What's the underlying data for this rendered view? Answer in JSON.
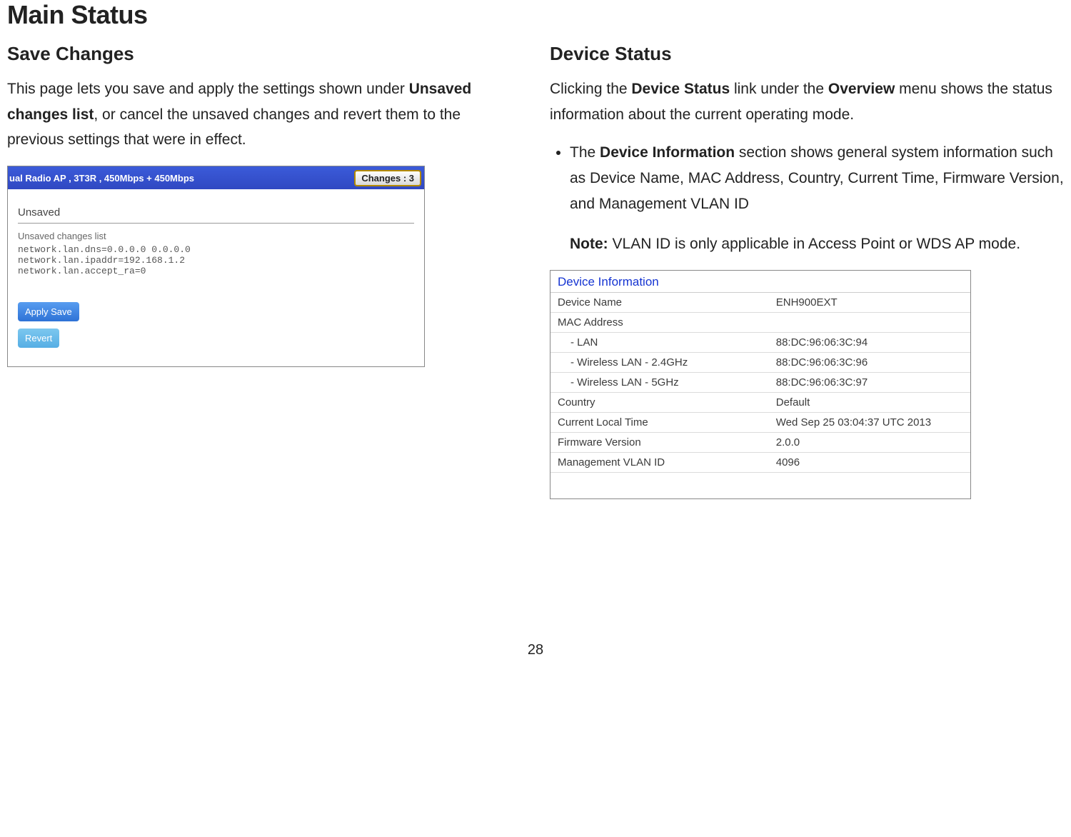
{
  "page_title": "Main Status",
  "page_number": "28",
  "left": {
    "heading": "Save Changes",
    "para_pre": "This page lets you save and apply the settings shown under ",
    "para_bold": "Unsaved changes list",
    "para_post": ", or cancel the unsaved changes and revert them to the previous settings that were in effect.",
    "shot": {
      "top_title": "ual Radio AP , 3T3R , 450Mbps + 450Mbps",
      "changes_btn": "Changes : 3",
      "unsaved_hdr": "Unsaved",
      "unsaved_sub": "Unsaved changes list",
      "lines": "network.lan.dns=0.0.0.0 0.0.0.0\nnetwork.lan.ipaddr=192.168.1.2\nnetwork.lan.accept_ra=0",
      "apply_label": "Apply Save",
      "revert_label": "Revert"
    }
  },
  "right": {
    "heading": "Device Status",
    "intro_1a": "Clicking the ",
    "intro_1b": "Device Status",
    "intro_1c": " link under the ",
    "intro_1d": "Overview",
    "intro_1e": " menu shows the status information about the current operating mode.",
    "bullet_a": "The ",
    "bullet_b": "Device Information",
    "bullet_c": " section shows general system information such as Device Name, MAC Address, Country, Current Time, Firmware Version, and Management VLAN ID",
    "note_label": "Note:",
    "note_text": " VLAN ID is only applicable in Access Point or WDS AP mode.",
    "table_title": "Device Information",
    "rows": {
      "device_name_l": "Device Name",
      "device_name_v": "ENH900EXT",
      "mac_l": "MAC Address",
      "lan_l": "- LAN",
      "lan_v": "88:DC:96:06:3C:94",
      "wlan24_l": "- Wireless LAN - 2.4GHz",
      "wlan24_v": "88:DC:96:06:3C:96",
      "wlan5_l": "- Wireless LAN - 5GHz",
      "wlan5_v": "88:DC:96:06:3C:97",
      "country_l": "Country",
      "country_v": "Default",
      "time_l": "Current Local Time",
      "time_v": "Wed Sep 25 03:04:37 UTC 2013",
      "fw_l": "Firmware Version",
      "fw_v": "2.0.0",
      "vlan_l": "Management VLAN ID",
      "vlan_v": "4096"
    }
  }
}
